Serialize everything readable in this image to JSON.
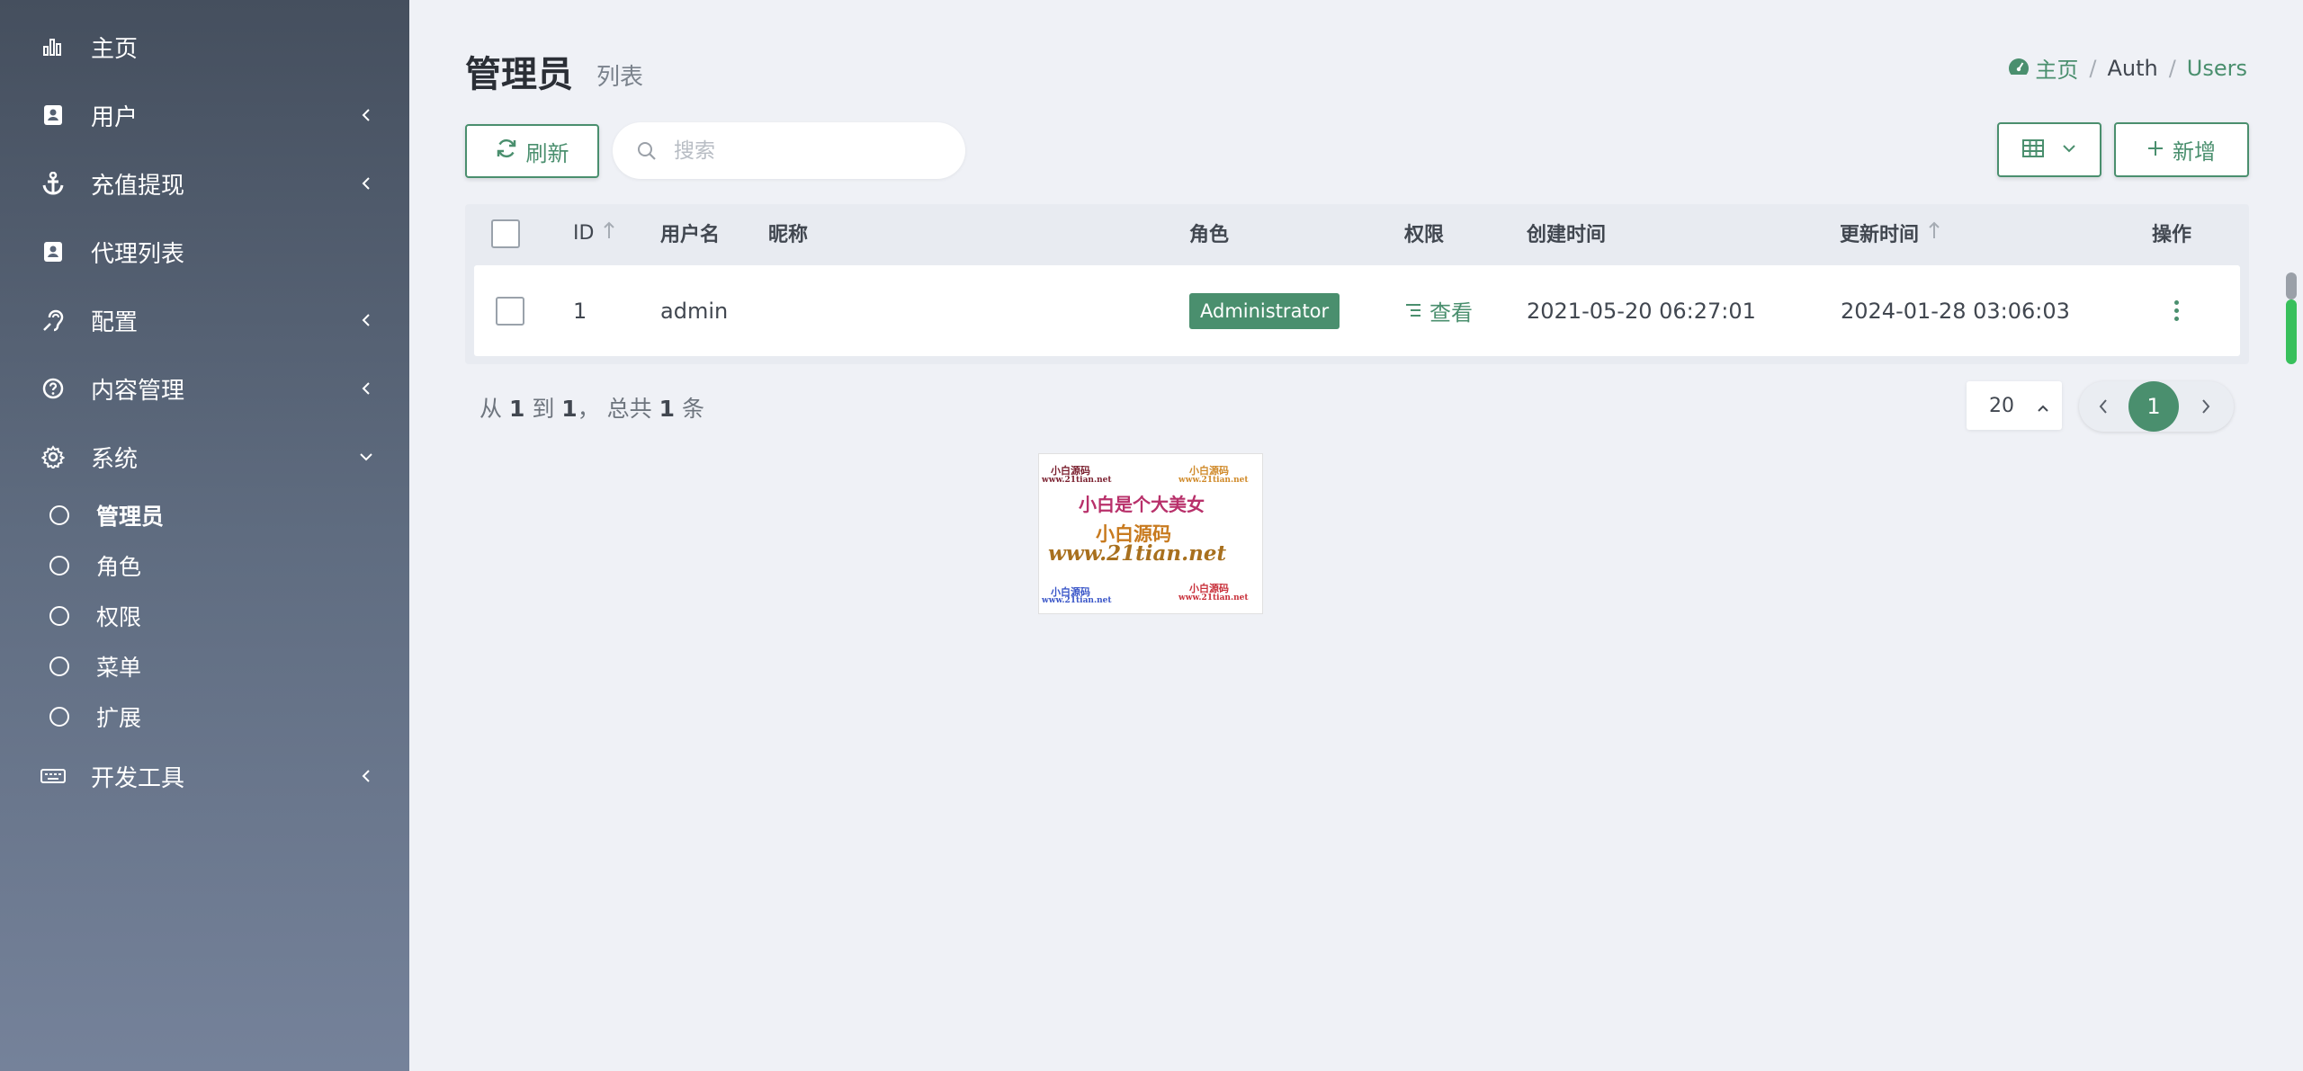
{
  "sidebar": {
    "items": [
      {
        "label": "主页",
        "icon": "chart-bar-icon",
        "arrow": "none"
      },
      {
        "label": "用户",
        "icon": "contact-card-icon",
        "arrow": "left"
      },
      {
        "label": "充值提现",
        "icon": "anchor-icon",
        "arrow": "left"
      },
      {
        "label": "代理列表",
        "icon": "contact-card-icon",
        "arrow": "none"
      },
      {
        "label": "配置",
        "icon": "hearing-icon",
        "arrow": "left"
      },
      {
        "label": "内容管理",
        "icon": "question-circle-icon",
        "arrow": "left"
      },
      {
        "label": "系统",
        "icon": "gear-icon",
        "arrow": "down"
      },
      {
        "label": "开发工具",
        "icon": "keyboard-icon",
        "arrow": "left"
      }
    ],
    "system_sub": [
      {
        "label": "管理员",
        "active": true
      },
      {
        "label": "角色",
        "active": false
      },
      {
        "label": "权限",
        "active": false
      },
      {
        "label": "菜单",
        "active": false
      },
      {
        "label": "扩展",
        "active": false
      }
    ]
  },
  "header": {
    "title": "管理员",
    "subtitle": "列表",
    "breadcrumb": {
      "home": "主页",
      "sep": "/",
      "auth": "Auth",
      "users": "Users"
    }
  },
  "toolbar": {
    "refresh_label": "刷新",
    "search_placeholder": "搜索",
    "add_label": "新增"
  },
  "table": {
    "columns": {
      "id": "ID",
      "username": "用户名",
      "nickname": "昵称",
      "role": "角色",
      "permission": "权限",
      "created": "创建时间",
      "updated": "更新时间",
      "actions": "操作"
    },
    "rows": [
      {
        "id": "1",
        "username": "admin",
        "nickname": "",
        "role": "Administrator",
        "permission": "查看",
        "created": "2021-05-20 06:27:01",
        "updated": "2024-01-28 03:06:03"
      }
    ]
  },
  "footer": {
    "summary_prefix": "从",
    "from": "1",
    "to_word": "到",
    "to": "1",
    "total_word": "， 总共",
    "total": "1",
    "unit": "条",
    "per_page": "20",
    "current_page": "1"
  },
  "watermark": {
    "top_left": "小白源码",
    "top_left_url": "www.21tian.net",
    "top_right": "小白源码",
    "top_right_url": "www.21tian.net",
    "headline": "小白是个大美女",
    "middle": "小白源码",
    "url": "www.21tian.net",
    "bottom_left": "小白源码",
    "bottom_left_url": "www.21tian.net",
    "bottom_right": "小白源码",
    "bottom_right_url": "www.21tian.net"
  },
  "colors": {
    "accent": "#4a8f6e",
    "sidebar_top": "#454f5e",
    "sidebar_bottom": "#75829a",
    "background": "#eff1f6"
  }
}
